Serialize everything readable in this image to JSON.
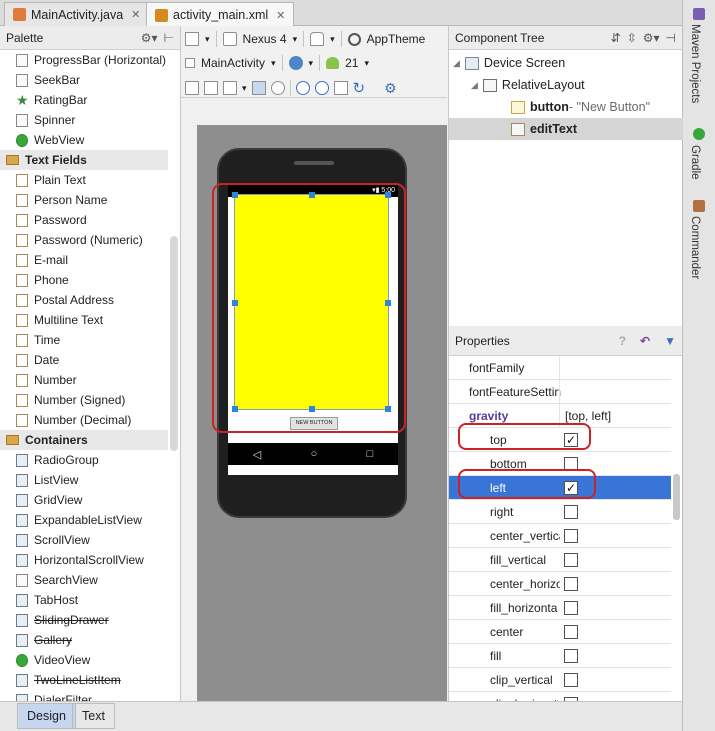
{
  "tabs": [
    {
      "label": "MainActivity.java",
      "color": "#e07b3b"
    },
    {
      "label": "activity_main.xml",
      "color": "#d48a1e"
    }
  ],
  "right_strip": [
    "Maven Projects",
    "Gradle",
    "Commander"
  ],
  "palette": {
    "title": "Palette",
    "items": [
      {
        "type": "item",
        "label": "ProgressBar (Horizontal)",
        "icon": "progressbar-icon"
      },
      {
        "type": "item",
        "label": "SeekBar",
        "icon": "seekbar-icon"
      },
      {
        "type": "item",
        "label": "RatingBar",
        "icon": "star-icon"
      },
      {
        "type": "item",
        "label": "Spinner",
        "icon": "spinner-icon"
      },
      {
        "type": "item",
        "label": "WebView",
        "icon": "globe-icon"
      },
      {
        "type": "cat",
        "label": "Text Fields"
      },
      {
        "type": "item",
        "label": "Plain Text",
        "icon": "textfield-icon"
      },
      {
        "type": "item",
        "label": "Person Name",
        "icon": "textfield-icon"
      },
      {
        "type": "item",
        "label": "Password",
        "icon": "textfield-icon"
      },
      {
        "type": "item",
        "label": "Password (Numeric)",
        "icon": "textfield-icon"
      },
      {
        "type": "item",
        "label": "E-mail",
        "icon": "textfield-icon"
      },
      {
        "type": "item",
        "label": "Phone",
        "icon": "textfield-icon"
      },
      {
        "type": "item",
        "label": "Postal Address",
        "icon": "textfield-icon"
      },
      {
        "type": "item",
        "label": "Multiline Text",
        "icon": "textfield-icon"
      },
      {
        "type": "item",
        "label": "Time",
        "icon": "textfield-icon"
      },
      {
        "type": "item",
        "label": "Date",
        "icon": "textfield-icon"
      },
      {
        "type": "item",
        "label": "Number",
        "icon": "textfield-icon"
      },
      {
        "type": "item",
        "label": "Number (Signed)",
        "icon": "textfield-icon"
      },
      {
        "type": "item",
        "label": "Number (Decimal)",
        "icon": "textfield-icon"
      },
      {
        "type": "cat",
        "label": "Containers"
      },
      {
        "type": "item",
        "label": "RadioGroup",
        "icon": "container-icon"
      },
      {
        "type": "item",
        "label": "ListView",
        "icon": "container-icon"
      },
      {
        "type": "item",
        "label": "GridView",
        "icon": "container-icon"
      },
      {
        "type": "item",
        "label": "ExpandableListView",
        "icon": "container-icon"
      },
      {
        "type": "item",
        "label": "ScrollView",
        "icon": "container-icon"
      },
      {
        "type": "item",
        "label": "HorizontalScrollView",
        "icon": "container-icon"
      },
      {
        "type": "item",
        "label": "SearchView",
        "icon": "search-icon"
      },
      {
        "type": "item",
        "label": "TabHost",
        "icon": "container-icon"
      },
      {
        "type": "item",
        "label": "SlidingDrawer",
        "icon": "container-icon",
        "deprecated": true
      },
      {
        "type": "item",
        "label": "Gallery",
        "icon": "container-icon",
        "deprecated": true
      },
      {
        "type": "item",
        "label": "VideoView",
        "icon": "video-icon"
      },
      {
        "type": "item",
        "label": "TwoLineListItem",
        "icon": "container-icon",
        "deprecated": true
      },
      {
        "type": "item",
        "label": "DialerFilter",
        "icon": "container-icon"
      }
    ]
  },
  "toolbar": {
    "device": "Nexus 4",
    "theme": "AppTheme",
    "activity": "MainActivity",
    "api": "21"
  },
  "phone": {
    "status_time": "5:00",
    "button_text": "NEW BUTTON",
    "nav_back": "◁",
    "nav_home": "○",
    "nav_recent": "□"
  },
  "component_tree": {
    "title": "Component Tree",
    "nodes": [
      {
        "label": "Device Screen",
        "sub": ""
      },
      {
        "label": "RelativeLayout",
        "sub": ""
      },
      {
        "label": "button",
        "sub": " - \"New Button\""
      },
      {
        "label": "editText",
        "sub": ""
      }
    ]
  },
  "properties": {
    "title": "Properties",
    "rows": [
      {
        "name": "fontFamily",
        "value": "",
        "kind": "text"
      },
      {
        "name": "fontFeatureSettin",
        "value": "",
        "kind": "text"
      },
      {
        "name": "gravity",
        "value": "[top, left]",
        "kind": "group"
      },
      {
        "name": "top",
        "checked": true,
        "kind": "check"
      },
      {
        "name": "bottom",
        "checked": false,
        "kind": "check"
      },
      {
        "name": "left",
        "checked": true,
        "kind": "check",
        "selected": true
      },
      {
        "name": "right",
        "checked": false,
        "kind": "check"
      },
      {
        "name": "center_vertica",
        "checked": false,
        "kind": "check"
      },
      {
        "name": "fill_vertical",
        "checked": false,
        "kind": "check"
      },
      {
        "name": "center_horizo",
        "checked": false,
        "kind": "check"
      },
      {
        "name": "fill_horizonta",
        "checked": false,
        "kind": "check"
      },
      {
        "name": "center",
        "checked": false,
        "kind": "check"
      },
      {
        "name": "fill",
        "checked": false,
        "kind": "check"
      },
      {
        "name": "clip_vertical",
        "checked": false,
        "kind": "check"
      },
      {
        "name": "clip_horizont",
        "checked": false,
        "kind": "check"
      }
    ]
  },
  "bottom_tabs": [
    "Design",
    "Text"
  ]
}
